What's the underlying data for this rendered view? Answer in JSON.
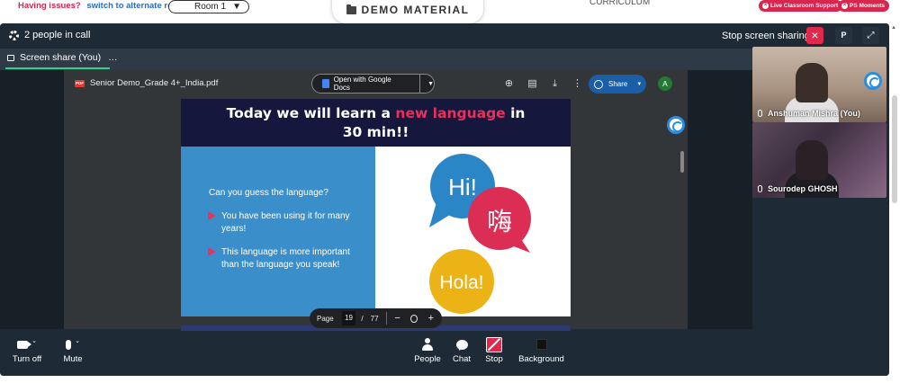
{
  "topbar": {
    "issues_text": "Having issues?",
    "alternate_link": "switch to alternate room",
    "room": "Room 1",
    "demo_material": "DEMO MATERIAL",
    "curriculum": "CURRICULUM",
    "live_support": "Live Classroom Support",
    "ps_moments": "PS Moments"
  },
  "call": {
    "people_count": "2 people in call",
    "stop_share": "Stop screen sharing",
    "p_label": "P",
    "tab_label": "Screen share (You)",
    "tab_menu": "…"
  },
  "pdf": {
    "badge": "PDF",
    "filename": "Senior Demo_Grade 4+_India.pdf",
    "open_with": "Open with Google Docs",
    "share": "Share",
    "avatar": "A",
    "page_label": "Page",
    "page_current": "19",
    "page_sep": "/",
    "page_total": "77"
  },
  "slide": {
    "title_pre": "Today we will learn a ",
    "title_highlight": "new language",
    "title_post": " in",
    "title_line2": "30 min!!",
    "question": "Can you guess the language?",
    "bullet1": "You have been using it for many years!",
    "bullet2": "This language is more important than the language you speak!",
    "bubble_hi": "Hi!",
    "bubble_chinese": "嗨",
    "bubble_hola": "Hola!"
  },
  "participants": [
    {
      "name": "Anshuman Mishra (You)"
    },
    {
      "name": "Sourodep GHOSH"
    }
  ],
  "controls": {
    "turn_off": "Turn off",
    "mute": "Mute",
    "people": "People",
    "chat": "Chat",
    "stop": "Stop",
    "background": "Background"
  },
  "colors": {
    "accent_red": "#e0284b",
    "slide_blue": "#3a8fcb",
    "slide_navy": "#15173d",
    "call_bg": "#1e2a35"
  }
}
